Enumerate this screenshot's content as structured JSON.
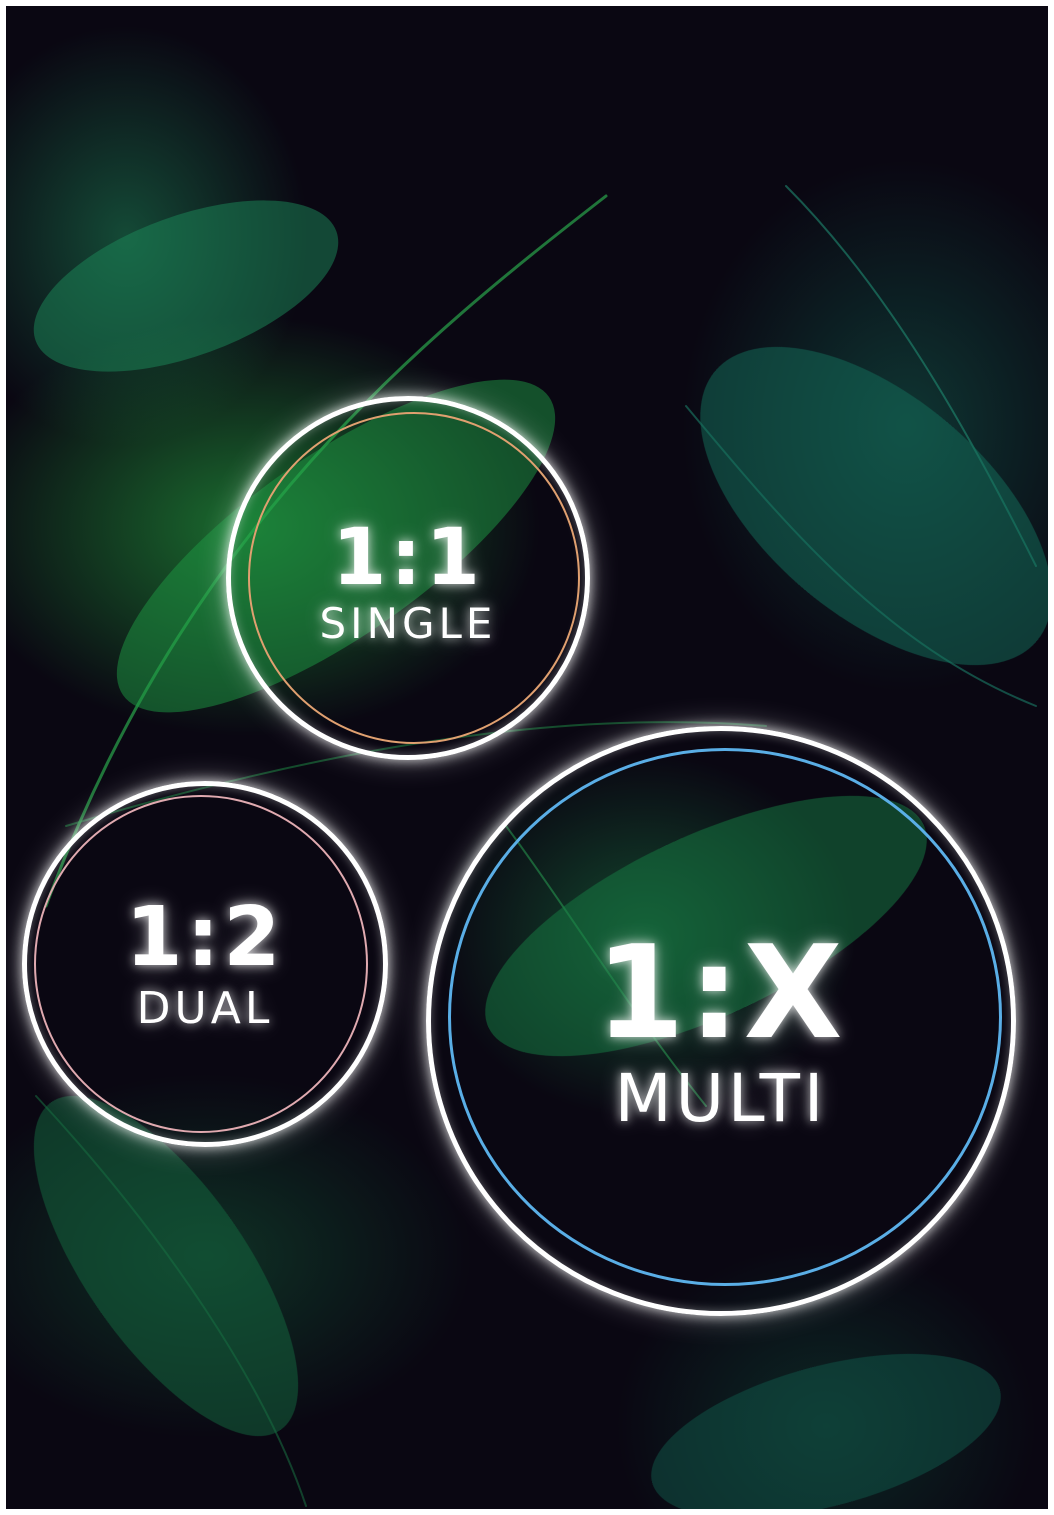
{
  "options": [
    {
      "id": "single",
      "ratio": "1:1",
      "mode": "SINGLE",
      "accent_color": "#e0a070"
    },
    {
      "id": "dual",
      "ratio": "1:2",
      "mode": "DUAL",
      "accent_color": "#e0aab0"
    },
    {
      "id": "multi",
      "ratio": "1:X",
      "mode": "MULTI",
      "accent_color": "#5aaee6"
    }
  ],
  "background": {
    "subject": "tropical-leaves",
    "base_color": "#0a0712",
    "leaf_color": "#1fa64a"
  }
}
